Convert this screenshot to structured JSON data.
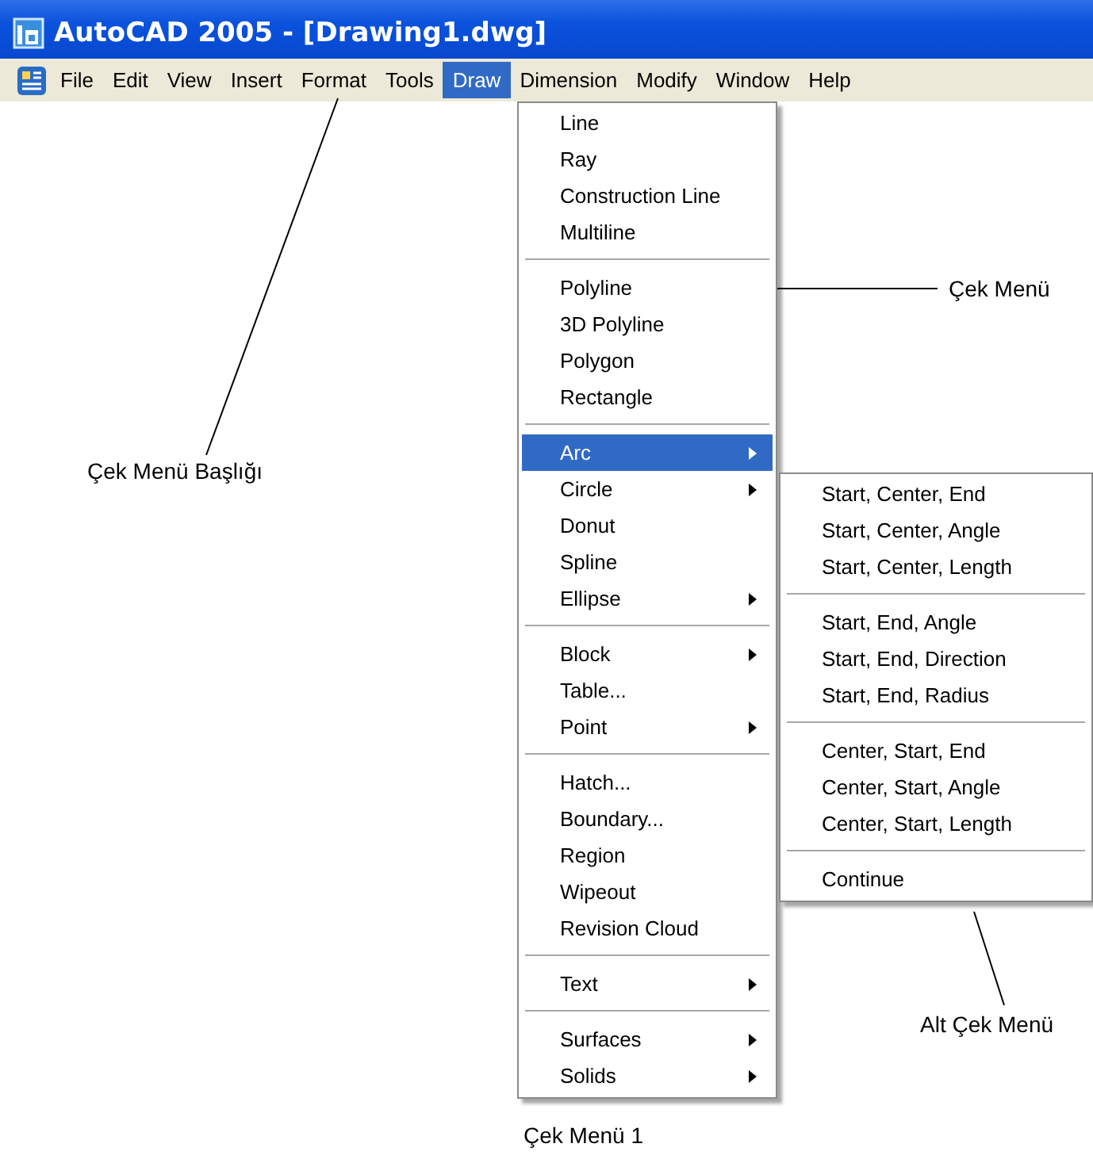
{
  "window": {
    "title": "AutoCAD 2005 - [Drawing1.dwg]"
  },
  "menu_bar": [
    {
      "label": "File",
      "selected": false
    },
    {
      "label": "Edit",
      "selected": false
    },
    {
      "label": "View",
      "selected": false
    },
    {
      "label": "Insert",
      "selected": false
    },
    {
      "label": "Format",
      "selected": false
    },
    {
      "label": "Tools",
      "selected": false
    },
    {
      "label": "Draw",
      "selected": true
    },
    {
      "label": "Dimension",
      "selected": false
    },
    {
      "label": "Modify",
      "selected": false
    },
    {
      "label": "Window",
      "selected": false
    },
    {
      "label": "Help",
      "selected": false
    }
  ],
  "draw_menu": {
    "groups": [
      [
        {
          "label": "Line",
          "submenu": false,
          "selected": false
        },
        {
          "label": "Ray",
          "submenu": false,
          "selected": false
        },
        {
          "label": "Construction Line",
          "submenu": false,
          "selected": false
        },
        {
          "label": "Multiline",
          "submenu": false,
          "selected": false
        }
      ],
      [
        {
          "label": "Polyline",
          "submenu": false,
          "selected": false
        },
        {
          "label": "3D Polyline",
          "submenu": false,
          "selected": false
        },
        {
          "label": "Polygon",
          "submenu": false,
          "selected": false
        },
        {
          "label": "Rectangle",
          "submenu": false,
          "selected": false
        }
      ],
      [
        {
          "label": "Arc",
          "submenu": true,
          "selected": true
        },
        {
          "label": "Circle",
          "submenu": true,
          "selected": false
        },
        {
          "label": "Donut",
          "submenu": false,
          "selected": false
        },
        {
          "label": "Spline",
          "submenu": false,
          "selected": false
        },
        {
          "label": "Ellipse",
          "submenu": true,
          "selected": false
        }
      ],
      [
        {
          "label": "Block",
          "submenu": true,
          "selected": false
        },
        {
          "label": "Table...",
          "submenu": false,
          "selected": false
        },
        {
          "label": "Point",
          "submenu": true,
          "selected": false
        }
      ],
      [
        {
          "label": "Hatch...",
          "submenu": false,
          "selected": false
        },
        {
          "label": "Boundary...",
          "submenu": false,
          "selected": false
        },
        {
          "label": "Region",
          "submenu": false,
          "selected": false
        },
        {
          "label": "Wipeout",
          "submenu": false,
          "selected": false
        },
        {
          "label": "Revision Cloud",
          "submenu": false,
          "selected": false
        }
      ],
      [
        {
          "label": "Text",
          "submenu": true,
          "selected": false
        }
      ],
      [
        {
          "label": "Surfaces",
          "submenu": true,
          "selected": false
        },
        {
          "label": "Solids",
          "submenu": true,
          "selected": false
        }
      ]
    ]
  },
  "arc_submenu": {
    "groups": [
      [
        {
          "label": "Start, Center, End",
          "submenu": false,
          "selected": false
        },
        {
          "label": "Start, Center, Angle",
          "submenu": false,
          "selected": false
        },
        {
          "label": "Start, Center, Length",
          "submenu": false,
          "selected": false
        }
      ],
      [
        {
          "label": "Start, End, Angle",
          "submenu": false,
          "selected": false
        },
        {
          "label": "Start, End, Direction",
          "submenu": false,
          "selected": false
        },
        {
          "label": "Start, End, Radius",
          "submenu": false,
          "selected": false
        }
      ],
      [
        {
          "label": "Center, Start, End",
          "submenu": false,
          "selected": false
        },
        {
          "label": "Center, Start, Angle",
          "submenu": false,
          "selected": false
        },
        {
          "label": "Center, Start, Length",
          "submenu": false,
          "selected": false
        }
      ],
      [
        {
          "label": "Continue",
          "submenu": false,
          "selected": false
        }
      ]
    ]
  },
  "annotations": [
    {
      "text": "Çek Menü Başlığı"
    },
    {
      "text": "Çek Menü"
    },
    {
      "text": "Alt Çek Menü"
    },
    {
      "text": "Çek Menü 1"
    }
  ]
}
